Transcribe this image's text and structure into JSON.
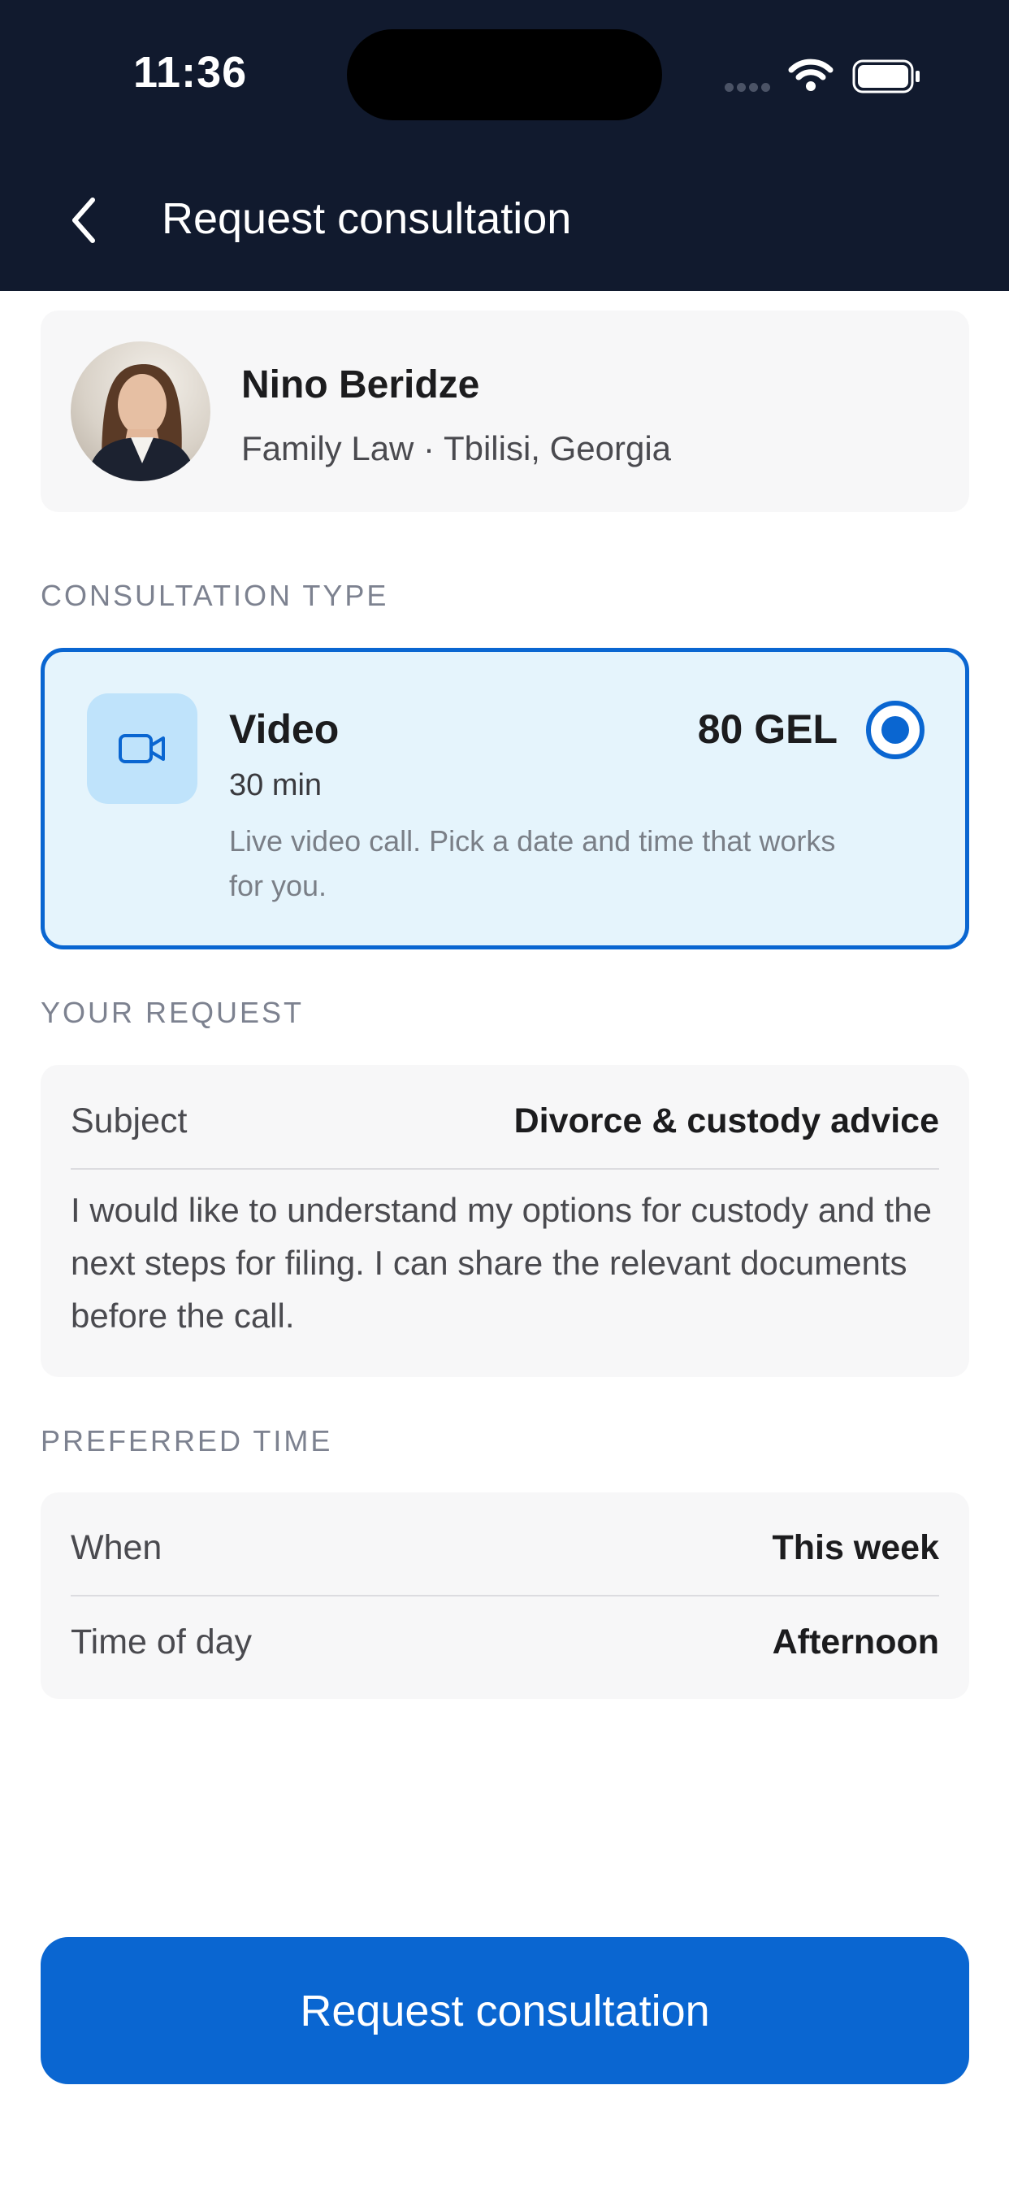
{
  "status_bar": {
    "time": "11:36"
  },
  "header": {
    "title": "Request consultation"
  },
  "lawyer": {
    "name": "Nino Beridze",
    "meta": "Family Law · Tbilisi, Georgia"
  },
  "consultation_type": {
    "section_label": "CONSULTATION TYPE",
    "option": {
      "title": "Video",
      "price": "80 GEL",
      "duration": "30 min",
      "description": "Live video call. Pick a date and time that works for you.",
      "selected": true
    }
  },
  "your_request": {
    "section_label": "YOUR REQUEST",
    "subject_label": "Subject",
    "subject_value": "Divorce & custody advice",
    "message": "I would like to understand my options for custody and the next steps for filing. I can share the relevant documents before the call."
  },
  "preferred_time": {
    "section_label": "PREFERRED TIME",
    "when_label": "When",
    "when_value": "This week",
    "time_of_day_label": "Time of day",
    "time_of_day_value": "Afternoon"
  },
  "cta": {
    "label": "Request consultation"
  },
  "colors": {
    "header_bg": "#111a2e",
    "accent": "#0a66d1",
    "selected_card_bg": "#e5f4fc",
    "icon_box_bg": "#bfe3fb"
  }
}
